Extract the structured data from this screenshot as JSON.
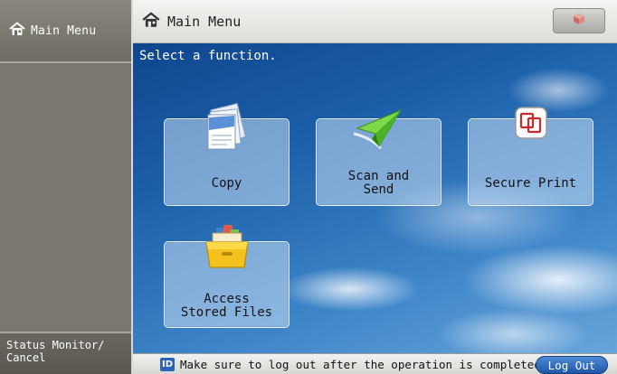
{
  "sidebar": {
    "main_menu_label": "Main Menu",
    "status_monitor_line1": "Status Monitor/",
    "status_monitor_line2": "Cancel"
  },
  "titlebar": {
    "title": "Main Menu"
  },
  "instruction": "Select a function.",
  "functions": {
    "copy": "Copy",
    "scan_send_line1": "Scan and",
    "scan_send_line2": "Send",
    "secure_print": "Secure Print",
    "access_line1": "Access",
    "access_line2": "Stored Files"
  },
  "statusbar": {
    "id_badge": "ID",
    "message": "Make sure to log out after the operation is completed.",
    "logout_label": "Log Out"
  },
  "colors": {
    "accent_blue": "#2c63b8",
    "sidebar_gray": "#7a776e"
  }
}
